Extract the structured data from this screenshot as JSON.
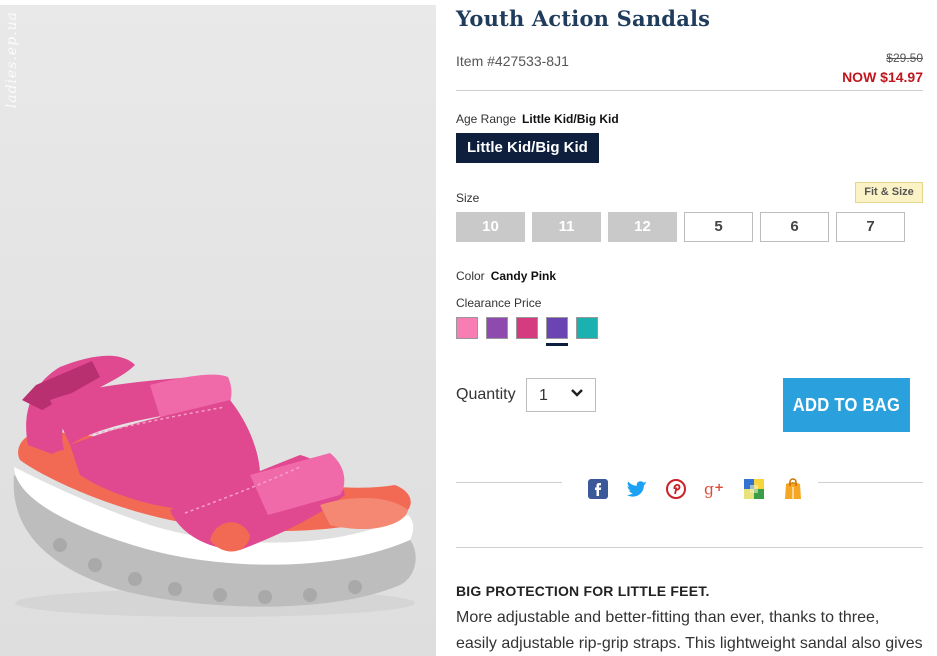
{
  "image": {
    "watermark": "ladies.ep.ua"
  },
  "product": {
    "title": "Youth Action Sandals",
    "item_number": "Item #427533-8J1",
    "price_old": "$29.50",
    "price_now": "NOW $14.97"
  },
  "age_range": {
    "label": "Age Range",
    "value": "Little Kid/Big Kid",
    "chip": "Little Kid/Big Kid"
  },
  "size": {
    "label": "Size",
    "fit_link": "Fit & Size",
    "options": [
      {
        "label": "10",
        "available": false
      },
      {
        "label": "11",
        "available": false
      },
      {
        "label": "12",
        "available": false
      },
      {
        "label": "5",
        "available": true
      },
      {
        "label": "6",
        "available": true
      },
      {
        "label": "7",
        "available": true
      }
    ]
  },
  "color": {
    "label": "Color",
    "value": "Candy Pink",
    "group_label": "Clearance Price",
    "swatches": [
      {
        "name": "candy-pink",
        "hex": "#f77db2"
      },
      {
        "name": "purple",
        "hex": "#8e4aae"
      },
      {
        "name": "magenta",
        "hex": "#d63a7f"
      },
      {
        "name": "violet",
        "hex": "#6a44b2",
        "selected": true
      },
      {
        "name": "teal",
        "hex": "#1cb1b1"
      }
    ]
  },
  "quantity": {
    "label": "Quantity",
    "value": "1"
  },
  "cta": {
    "add_to_bag": "ADD TO BAG",
    "color": "#2aa1dc"
  },
  "share": {
    "icons": [
      "facebook-icon",
      "twitter-icon",
      "pinterest-icon",
      "google-plus-icon",
      "delicious-icon",
      "shopping-bag-icon"
    ]
  },
  "description": {
    "heading": "BIG PROTECTION FOR LITTLE FEET.",
    "body": "More adjustable and better-fitting than ever, thanks to three, easily adjustable rip-grip straps. This lightweight sandal also gives him"
  },
  "colors": {
    "title": "#1f3c5c",
    "sale": "#c0161e",
    "navy": "#0e1f3d"
  }
}
